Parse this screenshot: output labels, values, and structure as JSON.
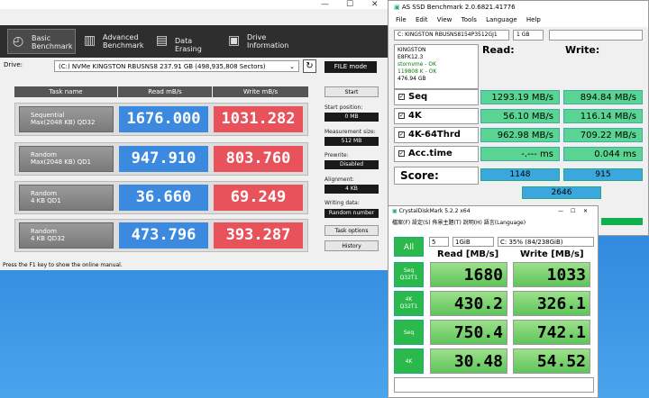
{
  "ssd_window": {
    "tabs": [
      {
        "label": "Basic\nBenchmark"
      },
      {
        "label": "Advanced\nBenchmark"
      },
      {
        "label": "Data Erasing"
      },
      {
        "label": "Drive\nInformation"
      }
    ],
    "drive_label": "Drive:",
    "drive_value": "(C:) NVMe KINGSTON RBUSNS8  237.91 GB (498,935,808 Sectors)",
    "file_mode": "FILE mode",
    "headers": {
      "task": "Task name",
      "read": "Read mB/s",
      "write": "Write mB/s"
    },
    "rows": [
      {
        "name": "Sequential\nMax(2048 KB) QD32",
        "read": "1676.000",
        "write": "1031.282"
      },
      {
        "name": "Random\nMax(2048 KB) QD1",
        "read": "947.910",
        "write": "803.760"
      },
      {
        "name": "Random\n4 KB QD1",
        "read": "36.660",
        "write": "69.249"
      },
      {
        "name": "Random\n4 KB QD32",
        "read": "473.796",
        "write": "393.287"
      }
    ],
    "start": "Start",
    "start_position_label": "Start position:",
    "start_position": "0 MB",
    "measurement_label": "Measurement size:",
    "measurement": "512 MB",
    "prewrite_label": "Prewrite:",
    "prewrite": "Disabled",
    "alignment_label": "Alignment:",
    "alignment": "4 KB",
    "writing_label": "Writing data:",
    "writing": "Random number",
    "task_options": "Task options",
    "history": "History",
    "status": "Press the F1 key to show the online manual."
  },
  "asssd": {
    "title": "AS SSD Benchmark 2.0.6821.41776",
    "menu": [
      "File",
      "Edit",
      "View",
      "Tools",
      "Language",
      "Help"
    ],
    "drive": "C: KINGSTON RBUSNS8154P3512GJ1",
    "size": "1 GB",
    "info": {
      "model": "KINGSTON",
      "fw": "E8FK12.3",
      "driver": "stornvme - OK",
      "align": "119808 K - OK",
      "capacity": "476.94 GB"
    },
    "read_label": "Read:",
    "write_label": "Write:",
    "rows": [
      {
        "name": "Seq",
        "read": "1293.19 MB/s",
        "write": "894.84 MB/s"
      },
      {
        "name": "4K",
        "read": "56.10 MB/s",
        "write": "116.14 MB/s"
      },
      {
        "name": "4K-64Thrd",
        "read": "962.98 MB/s",
        "write": "709.22 MB/s"
      },
      {
        "name": "Acc.time",
        "read": "-.--- ms",
        "write": "0.044 ms"
      }
    ],
    "score_label": "Score:",
    "score_read": "1148",
    "score_write": "915",
    "score_total": "2646"
  },
  "cdm": {
    "title": "CrystalDiskMark 5.2.2 x64",
    "menu": "檔案(F)  設定(S)  佈景主題(T)  說明(H)  語言(Language)",
    "all": "All",
    "runs": "5",
    "size": "1GiB",
    "drive": "C: 35% (84/238GiB)",
    "read_header": "Read [MB/s]",
    "write_header": "Write [MB/s]",
    "rows": [
      {
        "name": "Seq\nQ32T1",
        "read": "1680",
        "write": "1033"
      },
      {
        "name": "4K\nQ32T1",
        "read": "430.2",
        "write": "326.1"
      },
      {
        "name": "Seq",
        "read": "750.4",
        "write": "742.1"
      },
      {
        "name": "4K",
        "read": "30.48",
        "write": "54.52"
      }
    ]
  }
}
